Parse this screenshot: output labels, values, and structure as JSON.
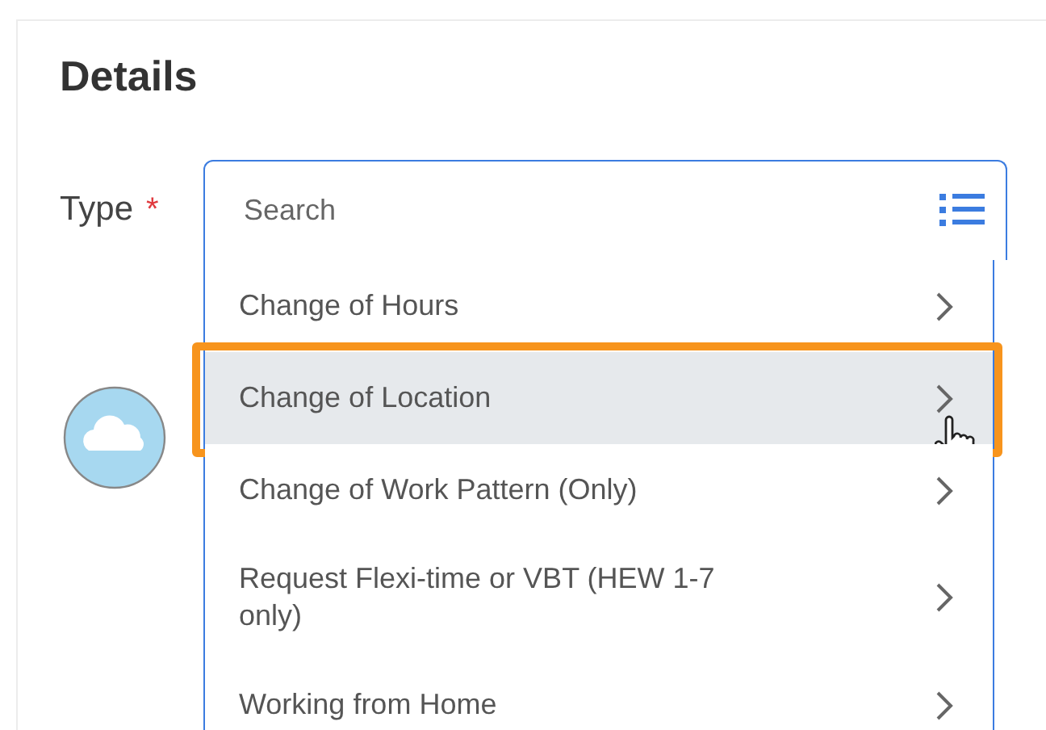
{
  "section": {
    "title": "Details"
  },
  "field": {
    "label": "Type",
    "required_mark": "*",
    "placeholder": "Search"
  },
  "options": [
    {
      "label": "Change of Hours",
      "highlighted": false
    },
    {
      "label": "Change of Location",
      "highlighted": true
    },
    {
      "label": "Change of Work Pattern (Only)",
      "highlighted": false
    },
    {
      "label": "Request Flexi-time or VBT (HEW 1-7 only)",
      "highlighted": false
    },
    {
      "label": "Working from Home",
      "highlighted": false
    }
  ]
}
